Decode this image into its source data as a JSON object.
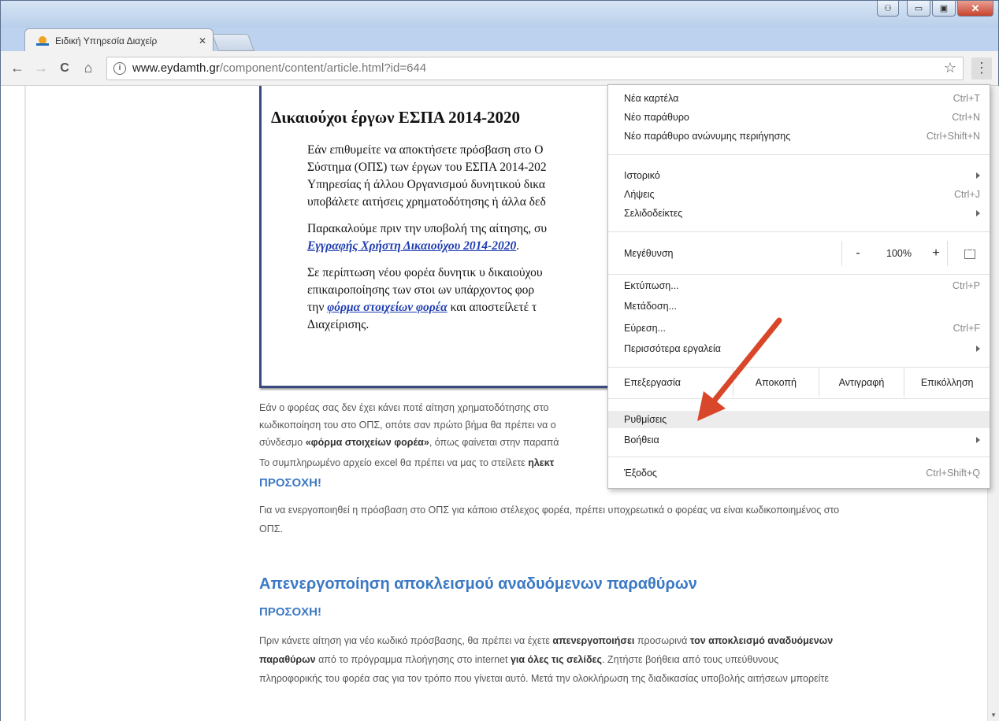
{
  "browser": {
    "tab_title": "Ειδική Υπηρεσία Διαχείρ",
    "tab_close": "✕",
    "url_host": "www.eydamth.gr",
    "url_path": "/component/content/article.html?id=644",
    "info_glyph": "i",
    "star_glyph": "☆",
    "menu_glyph": "⋮",
    "back_glyph": "←",
    "forward_glyph": "→",
    "reload_glyph": "C",
    "home_glyph": "⌂",
    "window_buttons": {
      "user": "⚇",
      "minimize": "▭",
      "maximize": "▣",
      "close": "✕"
    }
  },
  "article": {
    "boxed_title": "Δικαιούχοι έργων ΕΣΠΑ 2014-2020",
    "para1": [
      "Εάν επιθυμείτε να αποκτήσετε πρόσβαση στο Ο",
      "Σύστημα (ΟΠΣ) των έργων του ΕΣΠΑ 2014-202",
      "Υπηρεσίας ή άλλου Οργανισμού δυνητικού δικα",
      "υποβάλετε αιτήσεις χρηματοδότησης ή άλλα δεδ"
    ],
    "para2_line1": "Παρακαλούμε πριν την υποβολή της αίτησης, συ",
    "para2_link": "Εγγραφής Χρήστη Δικαιούχου 2014-2020",
    "para2_end": ".",
    "para3_line1": "Σε περίπτωση νέου φορέα δυνητικ  υ δικαιούχου",
    "para3_line2": "επικαιροποίησης των στοι  ων υπάρχοντος φορ",
    "para3_pre": "την ",
    "para3_link": "φόρμα στοιχείων φορέα",
    "para3_post": " και αποστείλετέ τ",
    "para3_line4": "Διαχείρισης.",
    "line_a1": "Εάν ο φορέας σας δεν έχει κάνει ποτέ αίτηση χρηματοδότησης στο",
    "line_a2": "κωδικοποίηση του στο ΟΠΣ, οπότε σαν πρώτο βήμα θα πρέπει να ο",
    "line_a3_pre": "σύνδεσμο ",
    "line_a3_bold": "«φόρμα στοιχείων φορέα»",
    "line_a3_post": ", όπως φαίνεται στην παραπά",
    "line_b_pre": "Το συμπληρωμένο αρχείο excel θα πρέπει να μας το στείλετε ",
    "line_b_bold": "ηλεκτ",
    "attention1": "ΠΡΟΣΟΧΗ!",
    "attention1_text1": "Για να ενεργοποιηθεί η πρόσβαση στο ΟΠΣ για κάποιο στέλεχος φορέα, πρέπει υποχρεωτικά ο φορέας να είναι κωδικοποιημένος στο",
    "attention1_text2": "ΟΠΣ.",
    "section_title": "Απενεργοποίηση αποκλεισμού αναδυόμενων παραθύρων",
    "attention2": "ΠΡΟΣΟΧΗ!",
    "final1_pre": "Πριν κάνετε αίτηση για νέο κωδικό πρόσβασης, θα πρέπει να έχετε ",
    "final1_b1": "απενεργοποιήσει",
    "final1_mid": " προσωρινά ",
    "final1_b2": "τον αποκλεισμό αναδυόμενων",
    "final2_b1": "παραθύρων",
    "final2_mid1": " από το πρόγραμμα πλοήγησης στο internet ",
    "final2_b2": "για όλες τις σελίδες",
    "final2_post": ". Ζητήστε βοήθεια από τους υπεύθυνους",
    "final3": "πληροφορικής του φορέα σας για τον τρόπο που γίνεται αυτό. Μετά την ολοκλήρωση της διαδικασίας υποβολής αιτήσεων μπορείτε"
  },
  "menu": {
    "new_tab": {
      "label": "Νέα καρτέλα",
      "shortcut": "Ctrl+T"
    },
    "new_window": {
      "label": "Νέο παράθυρο",
      "shortcut": "Ctrl+N"
    },
    "incognito": {
      "label": "Νέο παράθυρο ανώνυμης περιήγησης",
      "shortcut": "Ctrl+Shift+N"
    },
    "history": {
      "label": "Ιστορικό"
    },
    "downloads": {
      "label": "Λήψεις",
      "shortcut": "Ctrl+J"
    },
    "bookmarks": {
      "label": "Σελιδοδείκτες"
    },
    "zoom": {
      "label": "Μεγέθυνση",
      "minus": "-",
      "value": "100%",
      "plus": "+"
    },
    "print": {
      "label": "Εκτύπωση...",
      "shortcut": "Ctrl+P"
    },
    "cast": {
      "label": "Μετάδοση..."
    },
    "find": {
      "label": "Εύρεση...",
      "shortcut": "Ctrl+F"
    },
    "more_tools": {
      "label": "Περισσότερα εργαλεία"
    },
    "edit": {
      "label": "Επεξεργασία",
      "cut": "Αποκοπή",
      "copy": "Αντιγραφή",
      "paste": "Επικόλληση"
    },
    "settings": {
      "label": "Ρυθμίσεις"
    },
    "help": {
      "label": "Βοήθεια"
    },
    "exit": {
      "label": "Έξοδος",
      "shortcut": "Ctrl+Shift+Q"
    }
  },
  "colors": {
    "arrow": "#d9472a",
    "link": "#1f3db0",
    "heading": "#3c79c4"
  }
}
